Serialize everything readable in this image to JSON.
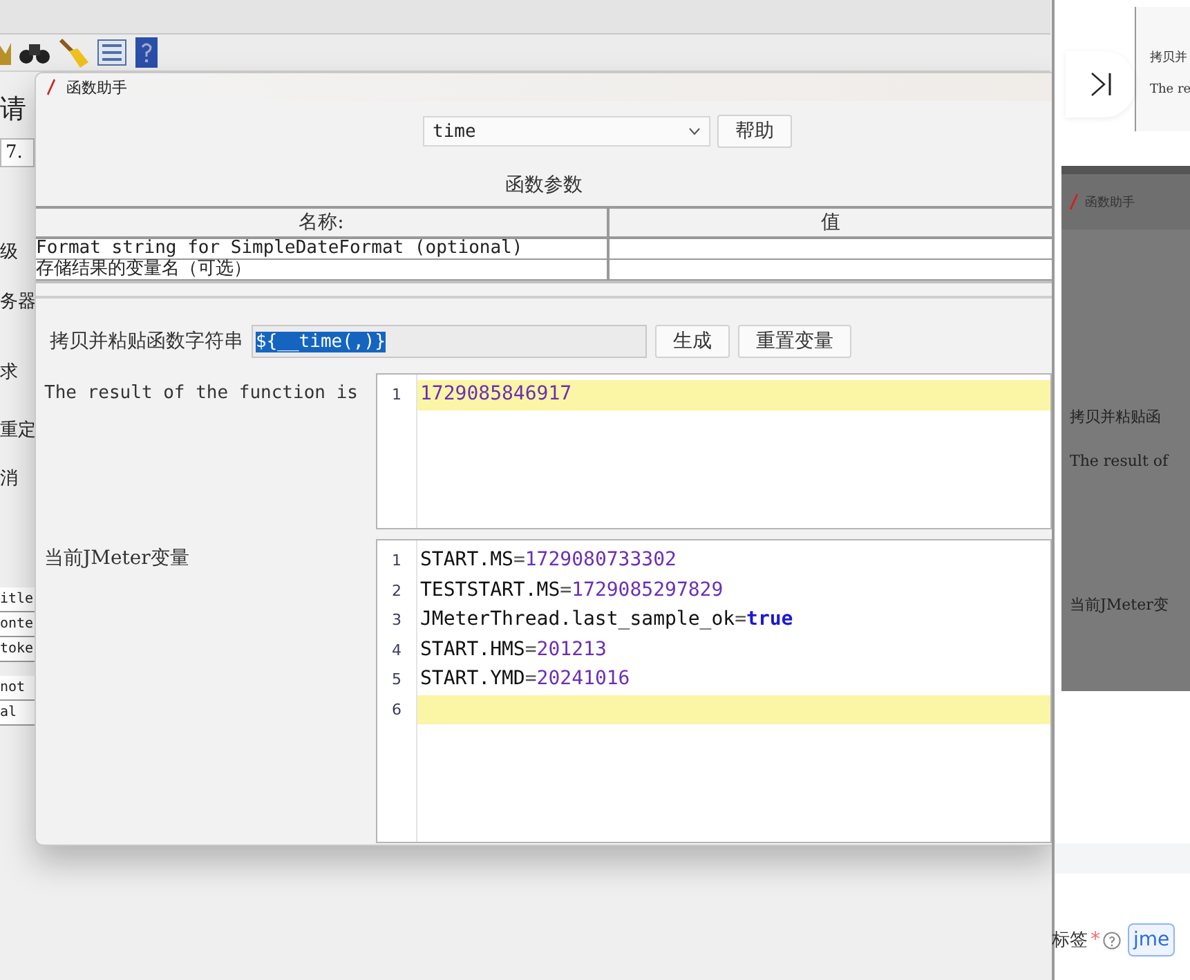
{
  "app": {
    "side_items": [
      {
        "kind": "heading",
        "text": "请"
      },
      {
        "kind": "field",
        "text": "7. "
      },
      {
        "kind": "label",
        "text": "级"
      },
      {
        "kind": "label",
        "text": "务器"
      },
      {
        "kind": "label",
        "text": "求"
      },
      {
        "kind": "label",
        "text": "重定"
      },
      {
        "kind": "label",
        "text": "消"
      },
      {
        "kind": "cell",
        "text": "itle"
      },
      {
        "kind": "cell",
        "text": "onte"
      },
      {
        "kind": "cell",
        "text": "toke"
      },
      {
        "kind": "cell",
        "text": "not"
      },
      {
        "kind": "cell",
        "text": "al"
      }
    ]
  },
  "dialog": {
    "title": "函数助手",
    "function": "time",
    "help_button": "帮助",
    "params_title": "函数参数",
    "table": {
      "columns": [
        "名称:",
        "值"
      ],
      "rows": [
        {
          "name": "Format string for SimpleDateFormat (optional)"
        },
        {
          "name": "存储结果的变量名（可选）"
        }
      ]
    },
    "copy_label": "拷贝并粘贴函数字符串",
    "copy_value": "${__time(,)}",
    "copy_selected": true,
    "generate_button": "生成",
    "reset_button": "重置变量",
    "result_label": "The result of the function is",
    "result_lines": [
      {
        "number": "1",
        "current": true,
        "tokens": [
          {
            "kind": "number",
            "text": "1729085846917"
          }
        ]
      }
    ],
    "vars_label": "当前JMeter变量",
    "vars_lines": [
      {
        "number": "1",
        "current": false,
        "tokens": [
          {
            "kind": "key",
            "text": "START.MS"
          },
          {
            "kind": "eq",
            "text": "="
          },
          {
            "kind": "number",
            "text": "1729080733302"
          }
        ]
      },
      {
        "number": "2",
        "current": false,
        "tokens": [
          {
            "kind": "key",
            "text": "TESTSTART.MS"
          },
          {
            "kind": "eq",
            "text": "="
          },
          {
            "kind": "number",
            "text": "1729085297829"
          }
        ]
      },
      {
        "number": "3",
        "current": false,
        "tokens": [
          {
            "kind": "key",
            "text": "JMeterThread.last_sample_ok"
          },
          {
            "kind": "eq",
            "text": "="
          },
          {
            "kind": "keyword",
            "text": "true"
          }
        ]
      },
      {
        "number": "4",
        "current": false,
        "tokens": [
          {
            "kind": "key",
            "text": "START.HMS"
          },
          {
            "kind": "eq",
            "text": "="
          },
          {
            "kind": "number",
            "text": "201213"
          }
        ]
      },
      {
        "number": "5",
        "current": false,
        "tokens": [
          {
            "kind": "key",
            "text": "START.YMD"
          },
          {
            "kind": "eq",
            "text": "="
          },
          {
            "kind": "number",
            "text": "20241016"
          }
        ]
      },
      {
        "number": "6",
        "current": true
      }
    ]
  },
  "side_panel": {
    "thumb_texts": [
      "拷贝并",
      "The re"
    ],
    "shot_title": "函数助手",
    "shot_texts": [
      "拷贝并粘贴函",
      "The result of",
      "当前JMeter变"
    ],
    "tag_label": "标签",
    "required_mark": "*",
    "tag_value": "jme"
  }
}
